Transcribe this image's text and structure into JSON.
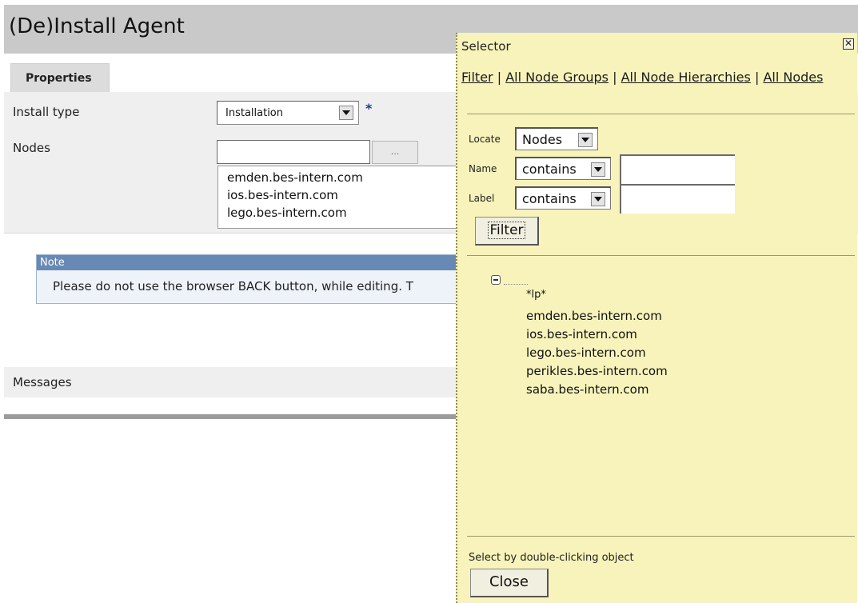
{
  "page": {
    "title": "(De)Install Agent",
    "tab_properties": "Properties",
    "install_type_label": "Install type",
    "install_type_value": "Installation",
    "required_marker": "*",
    "nodes_label": "Nodes",
    "browse_label": "...",
    "nodes": [
      "emden.bes-intern.com",
      "ios.bes-intern.com",
      "lego.bes-intern.com"
    ],
    "note_title": "Note",
    "note_text": "Please do not use the browser BACK button, while editing. T",
    "messages_label": "Messages"
  },
  "selector": {
    "title": "Selector",
    "close_glyph": "✕",
    "links": [
      "Filter",
      "All Node Groups",
      "All Node Hierarchies",
      "All Nodes"
    ],
    "separator": "|",
    "locate_label": "Locate",
    "locate_value": "Nodes",
    "name_label": "Name",
    "name_op": "contains",
    "label_label": "Label",
    "label_op": "contains",
    "filter_button": "Filter",
    "tree_group": "*lp*",
    "tree_items": [
      "emden.bes-intern.com",
      "ios.bes-intern.com",
      "lego.bes-intern.com",
      "perikles.bes-intern.com",
      "saba.bes-intern.com"
    ],
    "footer_hint": "Select by double-clicking object",
    "close_button": "Close"
  }
}
